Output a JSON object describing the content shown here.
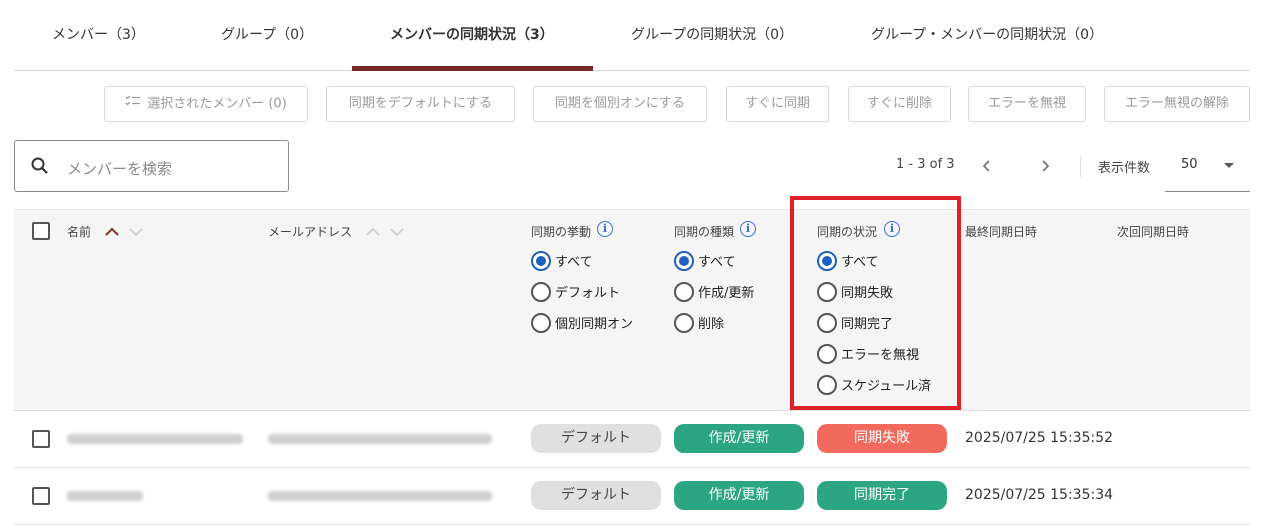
{
  "tabs": [
    {
      "label": "メンバー（3）"
    },
    {
      "label": "グループ（0）"
    },
    {
      "label": "メンバーの同期状況（3）"
    },
    {
      "label": "グループの同期状況（0）"
    },
    {
      "label": "グループ・メンバーの同期状況（0）"
    }
  ],
  "toolbar": {
    "selected_members": "選択されたメンバー (0)",
    "sync_default": "同期をデフォルトにする",
    "sync_individual_on": "同期を個別オンにする",
    "sync_now": "すぐに同期",
    "delete_now": "すぐに削除",
    "ignore_error": "エラーを無視",
    "unignore_error": "エラー無視の解除"
  },
  "search": {
    "placeholder": "メンバーを検索"
  },
  "pagination": {
    "range": "1 - 3 of 3",
    "per_page_label": "表示件数",
    "per_page_value": "50"
  },
  "columns": {
    "name": "名前",
    "email": "メールアドレス",
    "sync_behavior": "同期の挙動",
    "sync_type": "同期の種類",
    "sync_status": "同期の状況",
    "last_sync": "最終同期日時",
    "next_sync": "次回同期日時"
  },
  "filters": {
    "behavior": [
      {
        "label": "すべて",
        "selected": true
      },
      {
        "label": "デフォルト",
        "selected": false
      },
      {
        "label": "個別同期オン",
        "selected": false
      }
    ],
    "type": [
      {
        "label": "すべて",
        "selected": true
      },
      {
        "label": "作成/更新",
        "selected": false
      },
      {
        "label": "削除",
        "selected": false
      }
    ],
    "status": [
      {
        "label": "すべて",
        "selected": true
      },
      {
        "label": "同期失敗",
        "selected": false
      },
      {
        "label": "同期完了",
        "selected": false
      },
      {
        "label": "エラーを無視",
        "selected": false
      },
      {
        "label": "スケジュール済",
        "selected": false
      }
    ]
  },
  "rows": [
    {
      "behavior": "デフォルト",
      "type": "作成/更新",
      "status": "同期失敗",
      "status_color": "#f26a5d",
      "last_sync": "2025/07/25 15:35:52"
    },
    {
      "behavior": "デフォルト",
      "type": "作成/更新",
      "status": "同期完了",
      "status_color": "#2ba582",
      "last_sync": "2025/07/25 15:35:34"
    }
  ],
  "colors": {
    "accent": "#7b2a2a",
    "radio": "#1f5fc0",
    "highlight": "#e0202a",
    "success": "#2ba582",
    "failure": "#f26a5d"
  }
}
